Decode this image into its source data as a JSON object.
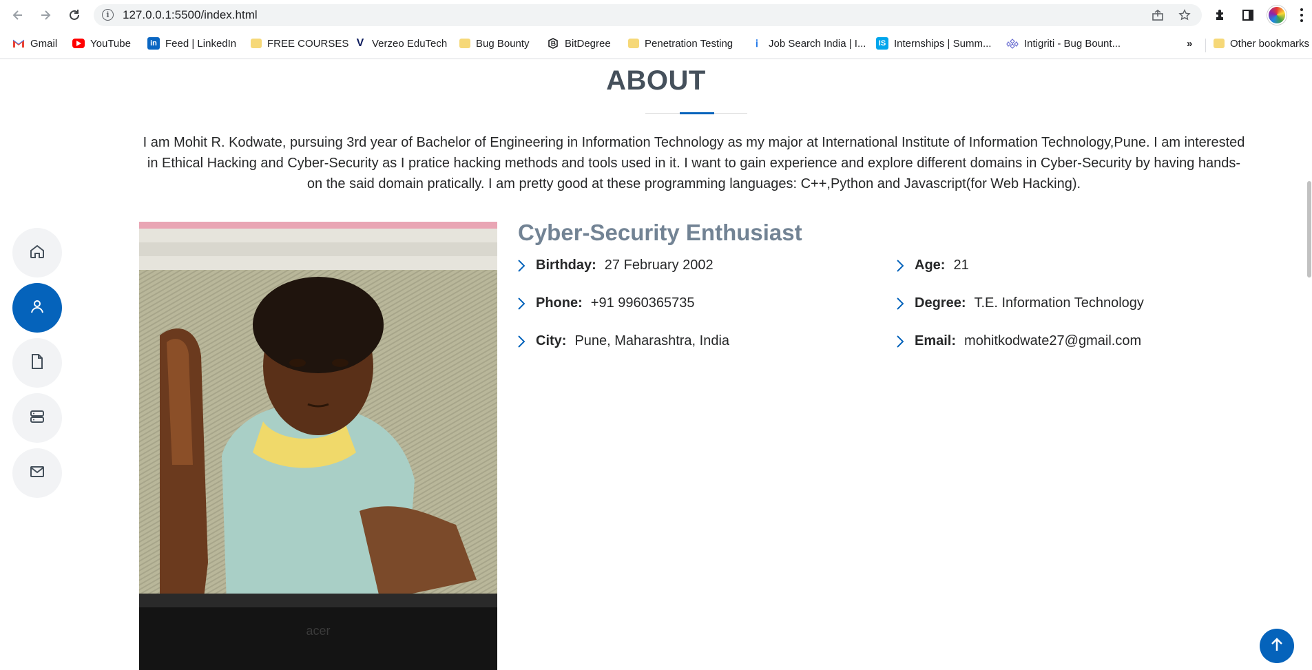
{
  "browser": {
    "url": "127.0.0.1:5500/index.html",
    "bookmarks": [
      {
        "label": "Gmail",
        "icon": "gmail-icon"
      },
      {
        "label": "YouTube",
        "icon": "youtube-icon"
      },
      {
        "label": "Feed | LinkedIn",
        "icon": "linkedin-icon"
      },
      {
        "label": "FREE COURSES",
        "icon": "folder-icon"
      },
      {
        "label": "Verzeo EduTech",
        "icon": "verzeo-icon"
      },
      {
        "label": "Bug Bounty",
        "icon": "folder-icon"
      },
      {
        "label": "BitDegree",
        "icon": "bitdegree-icon"
      },
      {
        "label": "Penetration Testing",
        "icon": "folder-icon"
      },
      {
        "label": "Job Search India | I...",
        "icon": "jobsearch-icon"
      },
      {
        "label": "Internships | Summ...",
        "icon": "internshala-icon"
      },
      {
        "label": "Intigriti - Bug Bount...",
        "icon": "intigriti-icon"
      }
    ],
    "overflow_label": "»",
    "other_bookmarks": "Other bookmarks"
  },
  "about": {
    "title": "ABOUT",
    "description": "I am Mohit R. Kodwate, pursuing 3rd year of Bachelor of Engineering in Information Technology as my major at International Institute of Information Technology,Pune. I am interested in Ethical Hacking and Cyber-Security as I pratice hacking methods and tools used in it. I want to gain experience and explore different domains in Cyber-Security by having hands-on the said domain pratically. I am pretty good at these programming languages: C++,Python and Javascript(for Web Hacking).",
    "role": "Cyber-Security Enthusiast",
    "details": {
      "birthday": {
        "label": "Birthday:",
        "value": "27 February 2002"
      },
      "age": {
        "label": "Age:",
        "value": "21"
      },
      "phone": {
        "label": "Phone:",
        "value": "+91 9960365735"
      },
      "degree": {
        "label": "Degree:",
        "value": "T.E. Information Technology"
      },
      "city": {
        "label": "City:",
        "value": "Pune, Maharashtra, India"
      },
      "email": {
        "label": "Email:",
        "value": "mohitkodwate27@gmail.com"
      }
    }
  },
  "nav": [
    {
      "icon": "home-icon",
      "active": false
    },
    {
      "icon": "user-icon",
      "active": true
    },
    {
      "icon": "file-icon",
      "active": false
    },
    {
      "icon": "server-icon",
      "active": false
    },
    {
      "icon": "envelope-icon",
      "active": false
    }
  ],
  "colors": {
    "accent": "#0563bb",
    "heading": "#45505b",
    "role": "#728394"
  }
}
